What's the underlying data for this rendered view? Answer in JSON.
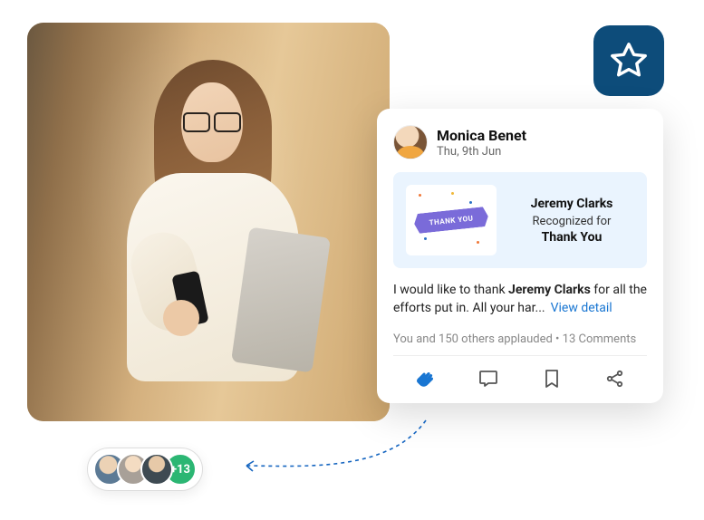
{
  "star_badge": {
    "icon": "star-outline"
  },
  "post": {
    "author": "Monica Benet",
    "date": "Thu, 9th Jun",
    "recognition": {
      "ribbon_text": "THANK YOU",
      "recipient": "Jeremy Clarks",
      "label": "Recognized for",
      "badge": "Thank You"
    },
    "body_prefix": "I would like to thank ",
    "body_bold": "Jeremy Clarks",
    "body_suffix": " for all the efforts put in. All your har...",
    "view_detail": "View detail",
    "stats": "You and 150 others applauded • 13 Comments"
  },
  "applauders": {
    "more": "+13"
  }
}
